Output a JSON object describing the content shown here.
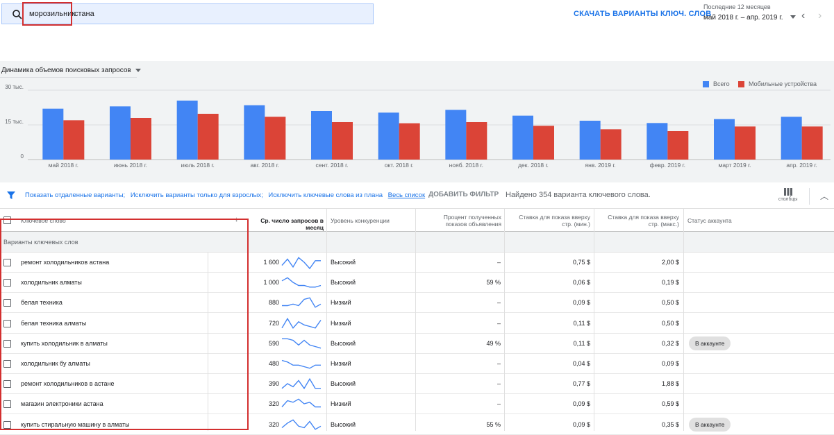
{
  "search": {
    "chips": [
      "морозильник",
      "стана"
    ]
  },
  "header": {
    "download_label": "СКАЧАТЬ ВАРИАНТЫ КЛЮЧ. СЛОВ",
    "period_label": "Последние 12 месяцев",
    "period_value": "май 2018 г. – апр. 2019 г."
  },
  "chart": {
    "title": "Динамика объемов поисковых запросов",
    "legend": [
      {
        "name": "Всего",
        "color": "#4285f4"
      },
      {
        "name": "Мобильные устройства",
        "color": "#db4437"
      }
    ]
  },
  "chart_data": {
    "type": "bar",
    "title": "",
    "categories": [
      "май 2018 г.",
      "июнь 2018 г.",
      "июль 2018 г.",
      "авг. 2018 г.",
      "сент. 2018 г.",
      "окт. 2018 г.",
      "нояб. 2018 г.",
      "дек. 2018 г.",
      "янв. 2019 г.",
      "февр. 2019 г.",
      "март 2019 г.",
      "апр. 2019 г."
    ],
    "series": [
      {
        "name": "Всего",
        "color": "#4285f4",
        "values": [
          22000,
          23000,
          25500,
          23500,
          21000,
          20300,
          21500,
          19000,
          16800,
          15800,
          17500,
          18500
        ]
      },
      {
        "name": "Мобильные устройства",
        "color": "#db4437",
        "values": [
          17000,
          18000,
          19800,
          18500,
          16200,
          15700,
          16200,
          14600,
          13100,
          12300,
          14300,
          14300
        ]
      }
    ],
    "yticks": [
      0,
      15000,
      30000
    ],
    "ytick_labels": [
      "0",
      "15 тыс.",
      "30 тыс."
    ],
    "ylim": [
      0,
      30000
    ],
    "grid": true,
    "legend_position": "top-right"
  },
  "filters": {
    "links": [
      "Показать отдаленные варианты;",
      "Исключить варианты только для взрослых;",
      "Исключить ключевые слова из плана"
    ],
    "all_list": "Весь список",
    "add_filter": "ДОБАВИТЬ ФИЛЬТР",
    "found": "Найдено 354 варианта ключевого слова.",
    "columns_label": "столбцы"
  },
  "table": {
    "headers": {
      "keyword": "Ключевое слово",
      "volume": "Ср. число запросов в месяц",
      "competition": "Уровень конкуренции",
      "impr_share_1": "Процент полученных",
      "impr_share_2": "показов объявления",
      "bid_min_1": "Ставка для показа вверху",
      "bid_min_2": "стр. (мин.)",
      "bid_max_1": "Ставка для показа вверху",
      "bid_max_2": "стр. (макс.)",
      "status": "Статус аккаунта"
    },
    "group_label": "Варианты ключевых слов",
    "rows": [
      {
        "keyword": "ремонт холодильников астана",
        "volume": "1 600",
        "competition": "Высокий",
        "impr": "–",
        "bid_min": "0,75 $",
        "bid_max": "2,00 $",
        "status": "",
        "trend": [
          6,
          2,
          7,
          1,
          4,
          8,
          3,
          3
        ]
      },
      {
        "keyword": "холодильник алматы",
        "volume": "1 000",
        "competition": "Высокий",
        "impr": "59 %",
        "bid_min": "0,06 $",
        "bid_max": "0,19 $",
        "status": "",
        "trend": [
          3,
          1,
          4,
          6,
          6,
          7,
          7,
          6
        ]
      },
      {
        "keyword": "белая техника",
        "volume": "880",
        "competition": "Низкий",
        "impr": "–",
        "bid_min": "0,09 $",
        "bid_max": "0,50 $",
        "status": "",
        "trend": [
          6,
          6,
          5,
          6,
          2,
          1,
          7,
          5
        ]
      },
      {
        "keyword": "белая техника алматы",
        "volume": "720",
        "competition": "Низкий",
        "impr": "–",
        "bid_min": "0,11 $",
        "bid_max": "0,50 $",
        "status": "",
        "trend": [
          7,
          1,
          7,
          3,
          5,
          6,
          7,
          2
        ]
      },
      {
        "keyword": "купить холодильник в алматы",
        "volume": "590",
        "competition": "Высокий",
        "impr": "49 %",
        "bid_min": "0,11 $",
        "bid_max": "0,32 $",
        "status": "В аккаунте",
        "trend": [
          1,
          1,
          2,
          5,
          2,
          5,
          6,
          7
        ]
      },
      {
        "keyword": "холодильник бу алматы",
        "volume": "480",
        "competition": "Низкий",
        "impr": "–",
        "bid_min": "0,04 $",
        "bid_max": "0,09 $",
        "status": "",
        "trend": [
          2,
          3,
          5,
          5,
          6,
          7,
          5,
          5
        ]
      },
      {
        "keyword": "ремонт холодильников в астане",
        "volume": "390",
        "competition": "Высокий",
        "impr": "–",
        "bid_min": "0,77 $",
        "bid_max": "1,88 $",
        "status": "",
        "trend": [
          7,
          4,
          6,
          2,
          7,
          1,
          7,
          7
        ]
      },
      {
        "keyword": "магазин электроники астана",
        "volume": "320",
        "competition": "Низкий",
        "impr": "–",
        "bid_min": "0,09 $",
        "bid_max": "0,59 $",
        "status": "",
        "trend": [
          6,
          2,
          3,
          1,
          4,
          3,
          6,
          6
        ]
      },
      {
        "keyword": "купить стиральную машину в алматы",
        "volume": "320",
        "competition": "Высокий",
        "impr": "55 %",
        "bid_min": "0,09 $",
        "bid_max": "0,35 $",
        "status": "В аккаунте",
        "trend": [
          6,
          3,
          1,
          5,
          6,
          2,
          7,
          5
        ]
      }
    ]
  }
}
